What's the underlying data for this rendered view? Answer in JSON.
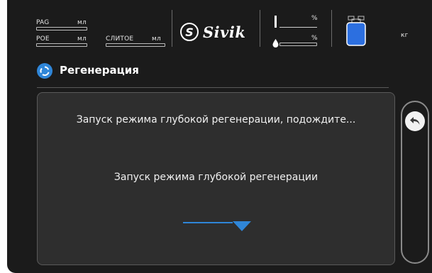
{
  "header": {
    "pag_label": "PAG",
    "pag_unit": "мл",
    "poe_label": "POE",
    "poe_unit": "мл",
    "drain_label": "СЛИТОЕ",
    "drain_unit": "мл",
    "brand": "Sivik",
    "pct_top": "%",
    "pct_bottom": "%",
    "weight_unit": "кг"
  },
  "section": {
    "title": "Регенерация"
  },
  "panel": {
    "status_message": "Запуск режима глубокой регенерации, подождите...",
    "sub_message": "Запуск режима глубокой регенерации"
  },
  "icons": {
    "section": "regeneration-icon",
    "back": "back-arrow-icon",
    "oil_drop": "drop-icon",
    "refrigerant_bottle": "refrigerant-bottle-icon"
  },
  "colors": {
    "accent": "#2f86d8",
    "background": "#1b1b1b",
    "panel": "#2e2e2e"
  }
}
